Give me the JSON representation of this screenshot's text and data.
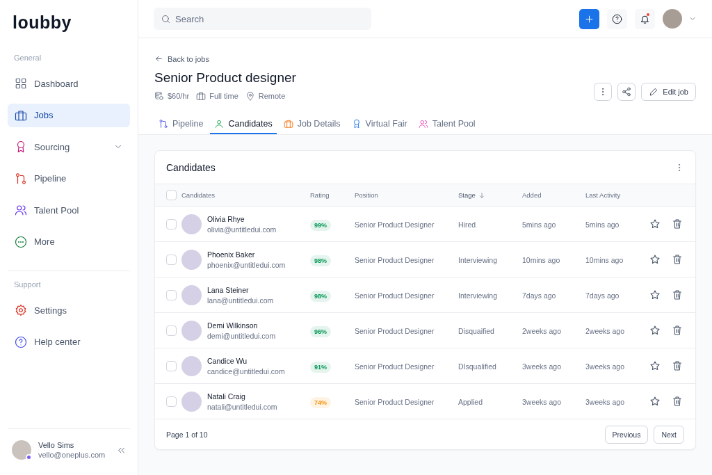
{
  "sidebar": {
    "logo": "loubby",
    "sections": [
      {
        "heading": "General",
        "items": [
          {
            "label": "Dashboard",
            "selected": false
          },
          {
            "label": "Jobs",
            "selected": true
          },
          {
            "label": "Sourcing",
            "selected": false,
            "expandable": true
          },
          {
            "label": "Pipeline",
            "selected": false
          },
          {
            "label": "Talent Pool",
            "selected": false
          },
          {
            "label": "More",
            "selected": false
          }
        ]
      },
      {
        "heading": "Support",
        "items": [
          {
            "label": "Settings",
            "selected": false
          },
          {
            "label": "Help center",
            "selected": false
          }
        ]
      }
    ],
    "user": {
      "name": "Vello Sims",
      "email": "vello@oneplus.com"
    }
  },
  "topbar": {
    "search": {
      "placeholder": "Search"
    }
  },
  "job": {
    "back": "Back to jobs",
    "title": "Senior Product designer",
    "meta": [
      "$60/hr",
      "Full time",
      "Remote"
    ],
    "edit_button": "Edit job"
  },
  "tabs": [
    {
      "label": "Pipeline",
      "selected": false
    },
    {
      "label": "Candidates",
      "selected": true
    },
    {
      "label": "Job Details",
      "selected": false
    },
    {
      "label": "Virtual Fair",
      "selected": false
    },
    {
      "label": "Talent Pool",
      "selected": false
    }
  ],
  "table": {
    "title": "Candidates",
    "all_checked": false,
    "columns": [
      {
        "label": "Candidates",
        "sorted": false
      },
      {
        "label": "Rating",
        "sorted": false
      },
      {
        "label": "Position",
        "sorted": false
      },
      {
        "label": "Stage",
        "sorted": true
      },
      {
        "label": "Added",
        "sorted": false
      },
      {
        "label": "Last Activity",
        "sorted": false
      }
    ],
    "rows": [
      {
        "checked": false,
        "name": "Olivia Rhye",
        "email": "olivia@untitledui.com",
        "rating": "99%",
        "color": "#039855",
        "position": "Senior Product Designer",
        "stage": "Hired",
        "added": "5mins ago",
        "last_activity": "5mins ago"
      },
      {
        "checked": false,
        "name": "Phoenix Baker",
        "email": "phoenix@untitledui.com",
        "rating": "98%",
        "color": "#039855",
        "position": "Senior Product Designer",
        "stage": "Interviewing",
        "added": "10mins ago",
        "last_activity": "10mins ago"
      },
      {
        "checked": false,
        "name": "Lana Steiner",
        "email": "lana@untitledui.com",
        "rating": "98%",
        "color": "#039855",
        "position": "Senior Product Designer",
        "stage": "Interviewing",
        "added": "7days ago",
        "last_activity": "7days ago"
      },
      {
        "checked": false,
        "name": "Demi Wilkinson",
        "email": "demi@untitledui.com",
        "rating": "96%",
        "color": "#039855",
        "position": "Senior Product Designer",
        "stage": "Disquaified",
        "added": "2weeks ago",
        "last_activity": "2weeks ago"
      },
      {
        "checked": false,
        "name": "Candice Wu",
        "email": "candice@untitledui.com",
        "rating": "91%",
        "color": "#039855",
        "position": "Senior Product Designer",
        "stage": "DIsqualified",
        "added": "3weeks ago",
        "last_activity": "3weeks ago"
      },
      {
        "checked": false,
        "name": "Natali Craig",
        "email": "natali@untitledui.com",
        "rating": "74%",
        "color": "#f79009",
        "position": "Senior Product Designer",
        "stage": "Applied",
        "added": "3weeks ago",
        "last_activity": "3weeks ago"
      }
    ],
    "page_info": "Page 1 of 10",
    "previous": "Previous",
    "next": "Next"
  }
}
